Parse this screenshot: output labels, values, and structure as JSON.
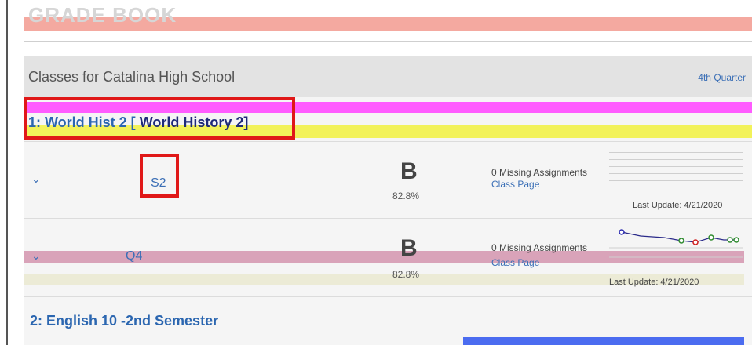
{
  "page": {
    "title": "GRADE BOOK"
  },
  "school": {
    "title": "Classes for Catalina High School",
    "quarter": "4th Quarter"
  },
  "classes": [
    {
      "title_prefix": "1: World Hist 2 [",
      "title_dark": "World History 2]",
      "terms": [
        {
          "term": "S2",
          "grade": "B",
          "percent": "82.8%",
          "missing": "0 Missing Assignments",
          "class_page": "Class Page",
          "updated": "Last Update: 4/21/2020"
        },
        {
          "term": "Q4",
          "grade": "B",
          "percent": "82.8%",
          "missing": "0 Missing Assignments",
          "class_page": "Class Page",
          "updated": "Last Update: 4/21/2020"
        }
      ]
    },
    {
      "title_prefix": "2: English 10 -2nd Semester"
    }
  ],
  "colors": {
    "link": "#3b6fb6",
    "highlight": "#e01818",
    "trend_line": "#2b2b8a",
    "trend_dot_blue": "#2b2bb0",
    "trend_dot_green": "#2e8b2e",
    "trend_dot_red": "#d02020"
  }
}
